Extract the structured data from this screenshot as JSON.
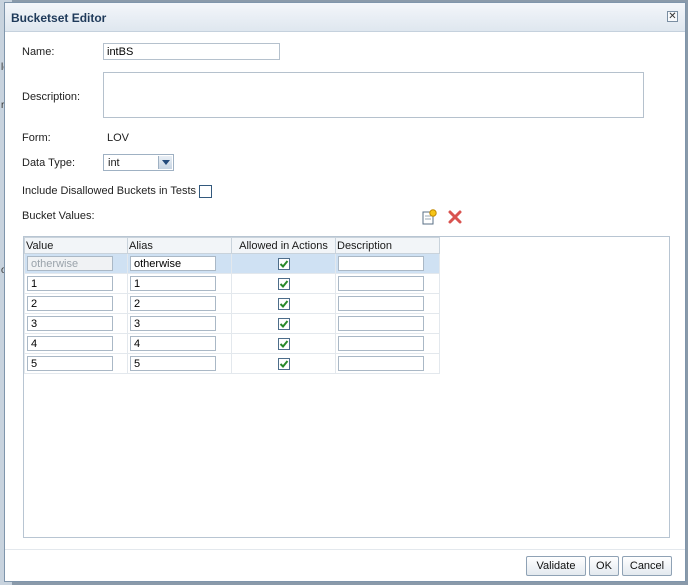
{
  "background": {
    "fragments": [
      "lo",
      "r",
      "or"
    ]
  },
  "dialog": {
    "title": "Bucketset Editor",
    "close_glyph": "✕",
    "name_label": "Name:",
    "name_value": "intBS",
    "description_label": "Description:",
    "description_value": "",
    "form_label": "Form:",
    "form_value": "LOV",
    "datatype_label": "Data Type:",
    "datatype_value": "int",
    "include_disallowed_label": "Include Disallowed Buckets in Tests",
    "include_disallowed_checked": false,
    "bucket_values_label": "Bucket Values:",
    "tool_icons": [
      "add-bucket-icon",
      "delete-bucket-icon"
    ]
  },
  "grid": {
    "columns": [
      "Value",
      "Alias",
      "Allowed in Actions",
      "Description"
    ],
    "rows": [
      {
        "value": "otherwise",
        "alias": "otherwise",
        "allowed": true,
        "description": ""
      },
      {
        "value": "1",
        "alias": "1",
        "allowed": true,
        "description": ""
      },
      {
        "value": "2",
        "alias": "2",
        "allowed": true,
        "description": ""
      },
      {
        "value": "3",
        "alias": "3",
        "allowed": true,
        "description": ""
      },
      {
        "value": "4",
        "alias": "4",
        "allowed": true,
        "description": ""
      },
      {
        "value": "5",
        "alias": "5",
        "allowed": true,
        "description": ""
      }
    ]
  },
  "buttons": {
    "validate": "Validate",
    "ok": "OK",
    "cancel": "Cancel"
  },
  "colors": {
    "accent": "#1f3a5a",
    "selected_row": "#cfe1f3",
    "check": "#2a8a2a",
    "delete": "#d9534f"
  }
}
